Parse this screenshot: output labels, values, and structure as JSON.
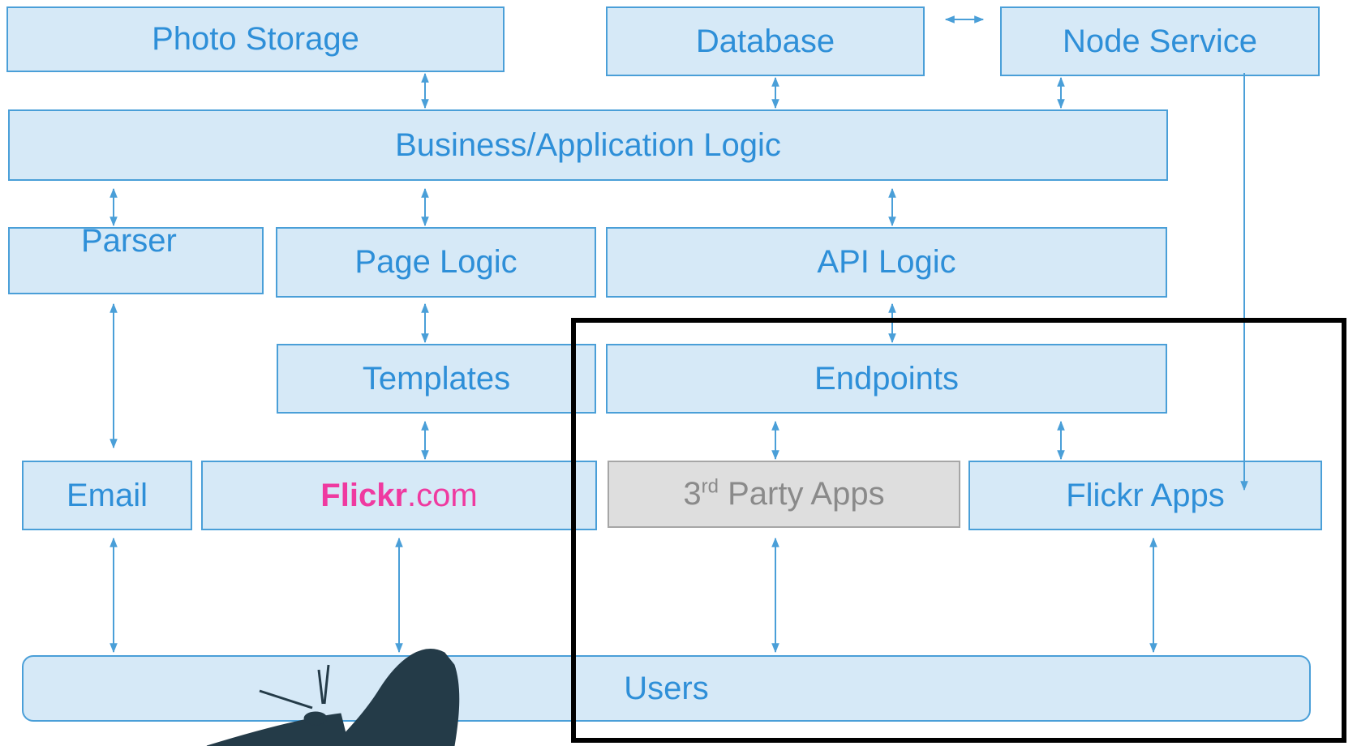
{
  "colors": {
    "box_fill": "#d6e9f7",
    "box_border": "#4a9fd8",
    "text": "#2e8fd8",
    "flickr_pink": "#ef3aa0",
    "gray_fill": "#dedede",
    "gray_text": "#8a8a8a",
    "highlight": "#000000",
    "butterfly": "#243b48"
  },
  "boxes": {
    "photo_storage": "Photo Storage",
    "database": "Database",
    "node_service": "Node Service",
    "business_logic": "Business/Application Logic",
    "parser": "Parser",
    "page_logic": "Page Logic",
    "api_logic": "API Logic",
    "templates": "Templates",
    "endpoints": "Endpoints",
    "email": "Email",
    "flickr_com": {
      "brand": "Flickr",
      "suffix": ".com"
    },
    "third_party_apps": {
      "prefix": "3",
      "sup": "rd",
      "rest": " Party Apps"
    },
    "flickr_apps": "Flickr Apps",
    "users": "Users"
  },
  "decorations": [
    "butterfly-silhouette",
    "black-highlight-frame"
  ]
}
